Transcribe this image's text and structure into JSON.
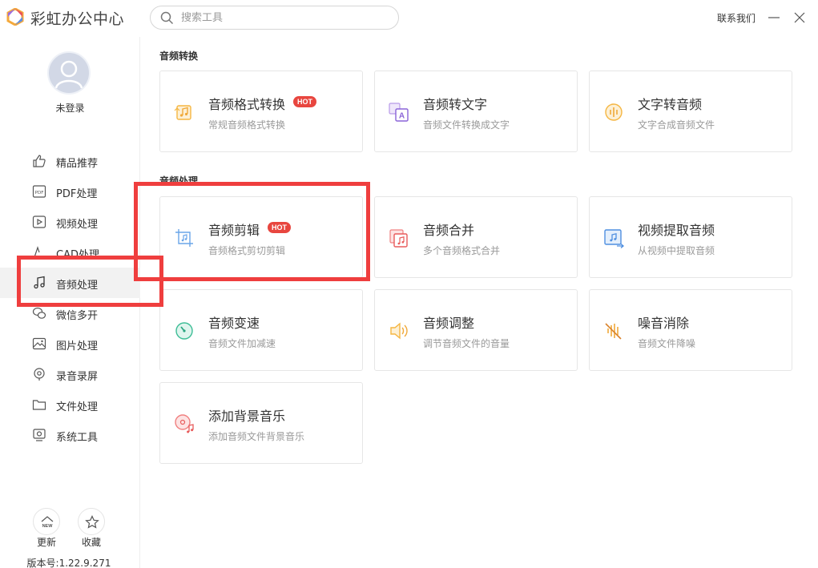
{
  "app": {
    "title": "彩虹办公中心"
  },
  "search": {
    "placeholder": "搜索工具"
  },
  "header": {
    "contact": "联系我们"
  },
  "user": {
    "login_status": "未登录"
  },
  "sidebar": {
    "items": [
      {
        "label": "精品推荐",
        "icon": "thumbs-up-icon"
      },
      {
        "label": "PDF处理",
        "icon": "pdf-icon"
      },
      {
        "label": "视频处理",
        "icon": "video-icon"
      },
      {
        "label": "CAD处理",
        "icon": "cad-icon"
      },
      {
        "label": "音频处理",
        "icon": "music-note-icon",
        "active": true
      },
      {
        "label": "微信多开",
        "icon": "wechat-icon"
      },
      {
        "label": "图片处理",
        "icon": "image-icon"
      },
      {
        "label": "录音录屏",
        "icon": "record-icon"
      },
      {
        "label": "文件处理",
        "icon": "folder-icon"
      },
      {
        "label": "系统工具",
        "icon": "system-icon"
      }
    ],
    "update_label": "更新",
    "update_badge": "NEW",
    "favorite_label": "收藏",
    "version": "版本号:1.22.9.271"
  },
  "sections": {
    "conversion": {
      "title": "音频转换",
      "cards": [
        {
          "title": "音频格式转换",
          "desc": "常规音频格式转换",
          "hot": "HOT",
          "icon": "audio-format-icon"
        },
        {
          "title": "音频转文字",
          "desc": "音频文件转换成文字",
          "icon": "audio-to-text-icon"
        },
        {
          "title": "文字转音频",
          "desc": "文字合成音频文件",
          "icon": "text-to-audio-icon"
        }
      ]
    },
    "processing": {
      "title": "音频处理",
      "cards": [
        {
          "title": "音频剪辑",
          "desc": "音频格式剪切剪辑",
          "hot": "HOT",
          "icon": "audio-crop-icon"
        },
        {
          "title": "音频合并",
          "desc": "多个音频格式合并",
          "icon": "audio-merge-icon"
        },
        {
          "title": "视频提取音频",
          "desc": "从视频中提取音频",
          "icon": "video-extract-audio-icon"
        },
        {
          "title": "音频变速",
          "desc": "音频文件加减速",
          "icon": "speed-gauge-icon"
        },
        {
          "title": "音频调整",
          "desc": "调节音频文件的音量",
          "icon": "volume-icon"
        },
        {
          "title": "噪音消除",
          "desc": "音频文件降噪",
          "icon": "noise-reduction-icon"
        },
        {
          "title": "添加背景音乐",
          "desc": "添加音频文件背景音乐",
          "icon": "background-music-icon"
        }
      ]
    }
  },
  "colors": {
    "accent_red": "#ef3e3e",
    "hot_badge": "#e8463f",
    "active_nav_bg": "#f2f2f2"
  }
}
